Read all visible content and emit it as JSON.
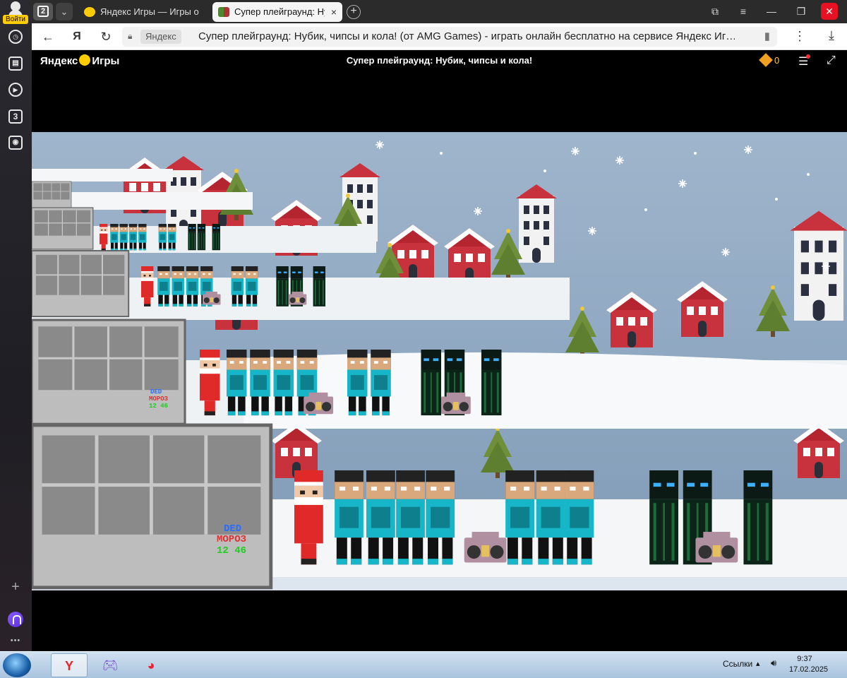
{
  "sidebar": {
    "login_label": "Войти",
    "tab_count_badge": "3"
  },
  "tabs": {
    "count": "2",
    "items": [
      {
        "title": "Яндекс Игры — Игры онл"
      },
      {
        "title": "Супер плейграунд: Нуб"
      }
    ],
    "close_glyph": "×",
    "new_tab_glyph": "+"
  },
  "address": {
    "domain": "Яндекс",
    "page_title": "Супер плейграунд: Нубик, чипсы и кола! (от AMG Games) - играть онлайн бесплатно на сервисе Яндекс Иг…",
    "ya_glyph": "Я"
  },
  "game_header": {
    "logo_left": "Яндекс",
    "logo_right": "Игры",
    "title": "Супер плейграунд: Нубик, чипсы и кола!",
    "coins": "0"
  },
  "game": {
    "sign_line1": "DED",
    "sign_line2": "МОРОЗ",
    "sign_line3": "12 46"
  },
  "taskbar": {
    "links_label": "Ссылки",
    "time": "9:37",
    "date": "17.02.2025"
  }
}
